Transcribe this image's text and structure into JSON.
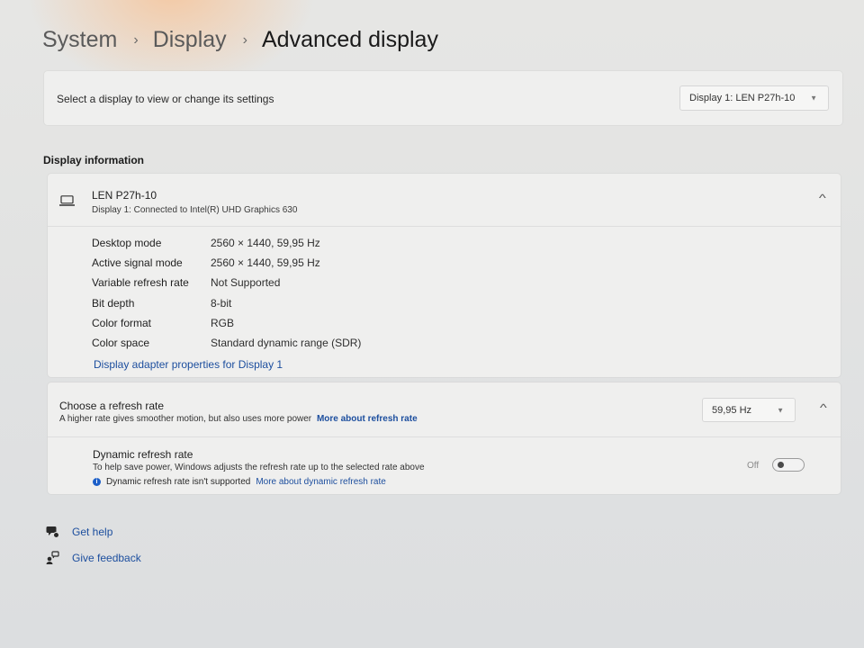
{
  "breadcrumb": {
    "items": [
      "System",
      "Display"
    ],
    "current": "Advanced display",
    "separator": "›"
  },
  "display_select": {
    "label": "Select a display to view or change its settings",
    "value": "Display 1: LEN P27h-10"
  },
  "display_info": {
    "heading": "Display information",
    "device_name": "LEN P27h-10",
    "device_sub": "Display 1: Connected to Intel(R) UHD Graphics 630",
    "rows": [
      {
        "key": "Desktop mode",
        "value": "2560 × 1440, 59,95 Hz"
      },
      {
        "key": "Active signal mode",
        "value": "2560 × 1440, 59,95 Hz"
      },
      {
        "key": "Variable refresh rate",
        "value": "Not Supported"
      },
      {
        "key": "Bit depth",
        "value": "8-bit"
      },
      {
        "key": "Color format",
        "value": "RGB"
      },
      {
        "key": "Color space",
        "value": "Standard dynamic range (SDR)"
      }
    ],
    "adapter_link": "Display adapter properties for Display 1"
  },
  "refresh": {
    "title": "Choose a refresh rate",
    "subtitle": "A higher rate gives smoother motion, but also uses more power",
    "more_link": "More about refresh rate",
    "value": "59,95 Hz",
    "dynamic": {
      "title": "Dynamic refresh rate",
      "subtitle": "To help save power, Windows adjusts the refresh rate up to the selected rate above",
      "note": "Dynamic refresh rate isn't supported",
      "note_link": "More about dynamic refresh rate",
      "toggle_label": "Off",
      "toggle_on": false
    }
  },
  "help": {
    "get_help": "Get help",
    "give_feedback": "Give feedback"
  },
  "colors": {
    "link": "#1c4e9e",
    "info_dot": "#1c5fc8",
    "card": "#efefee"
  }
}
